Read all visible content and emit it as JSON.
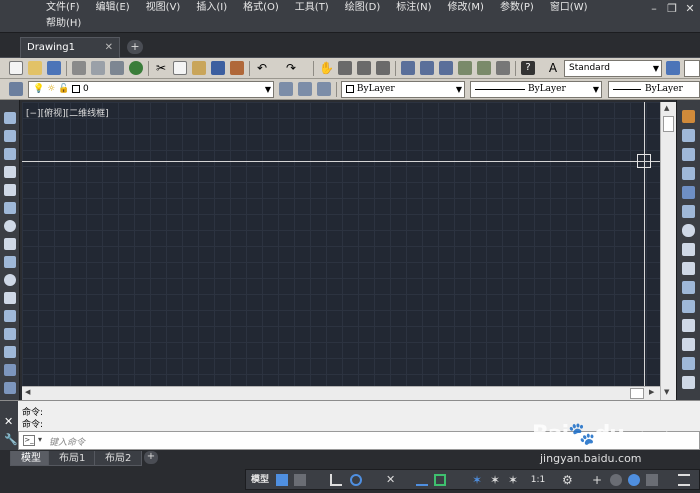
{
  "menu": {
    "items": [
      "文件(F)",
      "编辑(E)",
      "视图(V)",
      "插入(I)",
      "格式(O)",
      "工具(T)",
      "绘图(D)",
      "标注(N)",
      "修改(M)",
      "参数(P)",
      "窗口(W)",
      "帮助(H)"
    ],
    "window_controls": [
      "–",
      "❐",
      "✕"
    ]
  },
  "tabs": {
    "document": "Drawing1",
    "close": "✕",
    "new": "+"
  },
  "toolbar": {
    "text_style": "Standard",
    "layer": "0",
    "color": "ByLayer",
    "linetype": "ByLayer",
    "lineweight": "ByLayer"
  },
  "viewport": {
    "label": "[−][俯视][二维线框]"
  },
  "command": {
    "history": [
      "命令:",
      "命令:"
    ],
    "placeholder": "键入命令"
  },
  "layout_tabs": {
    "items": [
      "模型",
      "布局1",
      "布局2"
    ],
    "add": "+"
  },
  "status": {
    "model": "模型",
    "scale": "1:1"
  },
  "watermark": {
    "brand": "Bai",
    "tail": "du",
    "cn": "经验",
    "url": "jingyan.baidu.com"
  },
  "colors": {
    "canvas": "#222833",
    "grid": "#2c3340",
    "chrome_dark": "#3b3e44",
    "toolbar": "#d4d0c8"
  }
}
